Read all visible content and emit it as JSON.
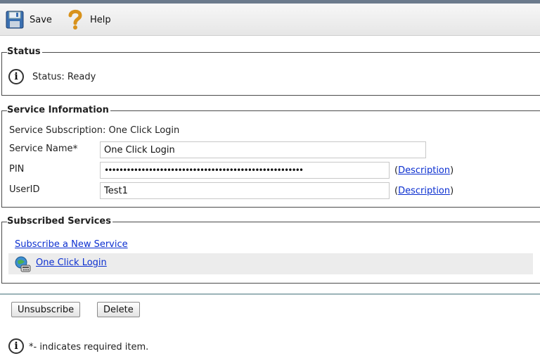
{
  "toolbar": {
    "save_label": "Save",
    "help_label": "Help",
    "save_icon": "floppy-disk-icon",
    "help_icon": "question-mark-icon"
  },
  "status": {
    "legend": "Status",
    "text": "Status: Ready",
    "icon": "info-icon",
    "icon_glyph": "i"
  },
  "service_info": {
    "legend": "Service Information",
    "subscription_label": "Service Subscription: One Click Login",
    "service_name_label": "Service Name",
    "required_marker": "*",
    "service_name_value": "One Click Login",
    "pin_label": "PIN",
    "pin_value": "••••••••••••••••••••••••••••••••••••••••••••••••••••••",
    "userid_label": "UserID",
    "userid_value": "Test1",
    "paren_open": "(",
    "paren_close": ")",
    "description_link": "Description"
  },
  "subscribed": {
    "legend": "Subscribed Services",
    "subscribe_link": "Subscribe a New Service",
    "items": [
      {
        "label": "One Click Login",
        "icon": "phone-service-icon"
      }
    ]
  },
  "actions": {
    "unsubscribe_label": "Unsubscribe",
    "delete_label": "Delete"
  },
  "footer": {
    "required_note": "*- indicates required item.",
    "icon_glyph": "i"
  }
}
